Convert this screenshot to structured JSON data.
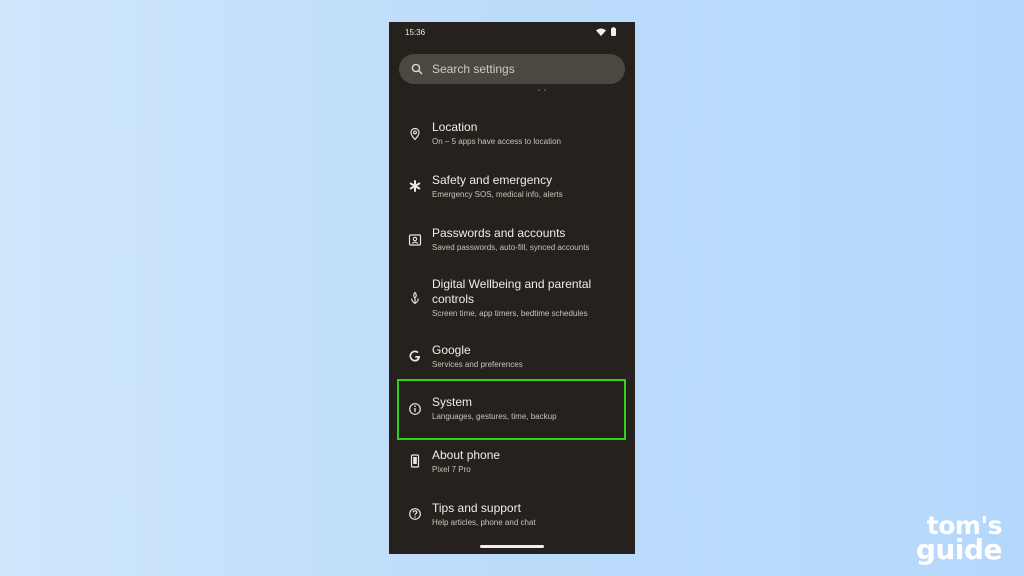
{
  "status_bar": {
    "time": "15:36"
  },
  "search": {
    "placeholder": "Search settings"
  },
  "items": [
    {
      "title": "Location",
      "subtitle": "On – 5 apps have access to location",
      "icon": "location-pin-icon"
    },
    {
      "title": "Safety and emergency",
      "subtitle": "Emergency SOS, medical info, alerts",
      "icon": "asterisk-icon"
    },
    {
      "title": "Passwords and accounts",
      "subtitle": "Saved passwords, auto-fill, synced accounts",
      "icon": "account-box-icon"
    },
    {
      "title_line1": "Digital Wellbeing and parental",
      "title_line2": "controls",
      "subtitle": "Screen time, app timers, bedtime schedules",
      "icon": "wellbeing-icon"
    },
    {
      "title": "Google",
      "subtitle": "Services and preferences",
      "icon": "google-g-icon"
    },
    {
      "title": "System",
      "subtitle": "Languages, gestures, time, backup",
      "icon": "info-icon"
    },
    {
      "title": "About phone",
      "subtitle": "Pixel 7 Pro",
      "icon": "phone-icon"
    },
    {
      "title": "Tips and support",
      "subtitle": "Help articles, phone and chat",
      "icon": "help-circle-icon"
    }
  ],
  "highlight_color": "#32d11f",
  "brand": {
    "line1": "tom's",
    "line2": "guide"
  }
}
